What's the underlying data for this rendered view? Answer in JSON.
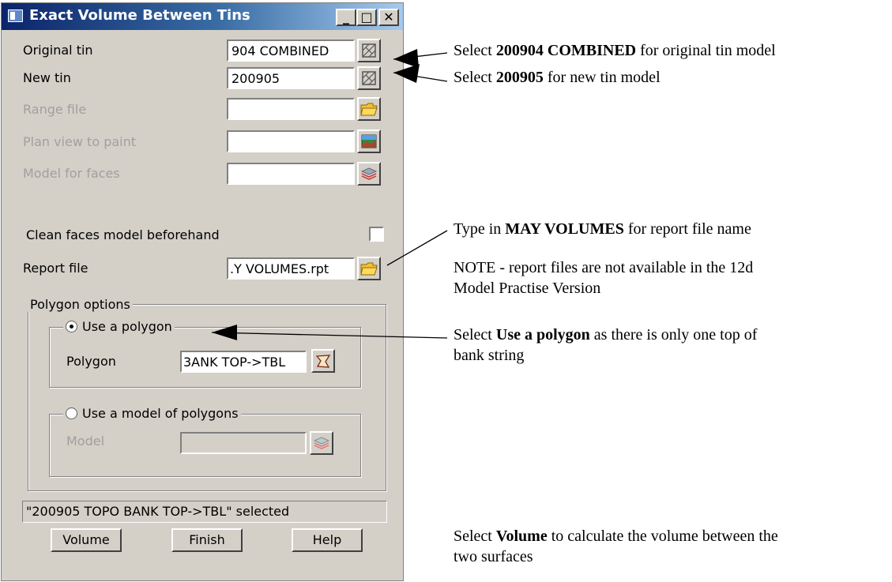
{
  "window": {
    "title": "Exact Volume Between Tins",
    "minimize_glyph": "_",
    "maximize_glyph": "□",
    "close_glyph": "✕"
  },
  "fields": {
    "original_tin": {
      "label": "Original tin",
      "value": "904 COMBINED",
      "button_icon": "tin-select-icon"
    },
    "new_tin": {
      "label": "New tin",
      "value": "200905",
      "button_icon": "tin-select-icon"
    },
    "range_file": {
      "label": "Range file",
      "value": "",
      "button_icon": "folder-icon"
    },
    "plan_view": {
      "label": "Plan view to paint",
      "value": "",
      "button_icon": "plan-view-icon"
    },
    "model_faces": {
      "label": "Model for faces",
      "value": "",
      "button_icon": "model-layers-icon"
    },
    "clean_faces": {
      "label": "Clean faces model beforehand",
      "checked": false
    },
    "report_file": {
      "label": "Report file",
      "value": ".Y VOLUMES.rpt",
      "button_icon": "folder-icon"
    }
  },
  "polygon_options": {
    "legend": "Polygon options",
    "use_polygon": {
      "label": "Use a polygon",
      "selected": true,
      "field_label": "Polygon",
      "value": "3ANK TOP->TBL",
      "button_icon": "polygon-select-icon"
    },
    "use_model": {
      "label": "Use a model of polygons",
      "selected": false,
      "field_label": "Model",
      "value": "",
      "button_icon": "model-layers-icon"
    }
  },
  "status_text": "\"200905 TOPO BANK TOP->TBL\" selected",
  "buttons": {
    "volume": "Volume",
    "finish": "Finish",
    "help": "Help"
  },
  "annotations": {
    "a1": {
      "pre": "Select ",
      "bold": "200904 COMBINED",
      "post": " for original tin model"
    },
    "a2": {
      "pre": "Select ",
      "bold": "200905",
      "post": " for new tin model"
    },
    "a3": {
      "pre": "Type in ",
      "bold": "MAY VOLUMES",
      "post": " for report file name"
    },
    "a4": {
      "line1": "NOTE - report files are not available in the 12d",
      "line2": "Model Practise Version"
    },
    "a5": {
      "pre": "Select ",
      "bold": "Use a polygon",
      "post": " as there is only one top of",
      "line2": "bank string"
    },
    "a6": {
      "pre": "Select ",
      "bold": "Volume",
      "post": " to calculate the volume between the",
      "line2": "two surfaces"
    }
  }
}
